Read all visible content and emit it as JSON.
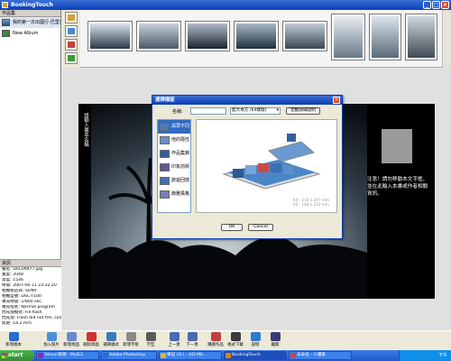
{
  "window": {
    "title": "BookingTouch"
  },
  "left_panel": {
    "header": "作品集",
    "albums": [
      {
        "label": "我的第一次出國行-巴里島",
        "icon": "photo-album-icon"
      },
      {
        "label": "New Album",
        "icon": "new-album-icon"
      }
    ],
    "info": {
      "header": "資訊",
      "rows": [
        "檔名: DSC09477.jpg",
        "寬度: 2048",
        "高度: 1536",
        "時間: 2007:06:11 23:32:20",
        "相機製造商: SONY",
        "相機型號: DSC-T100",
        "曝光時間: 1/800 sec.",
        "曝光程式: Normal program",
        "閃光燈模式: Fill flash",
        "閃光燈: Flash did not fire, compul",
        "焦距: 14.2 mm"
      ]
    }
  },
  "side_tools": [
    {
      "name": "photo-tool-icon"
    },
    {
      "name": "picture-tool-icon"
    },
    {
      "name": "paint-tool-icon"
    },
    {
      "name": "grid-tool-icon"
    }
  ],
  "thumbnails": [
    {
      "name": "sunset-sky",
      "colors": [
        "#2a3a4a",
        "#d8e2ea"
      ]
    },
    {
      "name": "couple-selfie",
      "colors": [
        "#4a5a6a",
        "#c8d0d8"
      ]
    },
    {
      "name": "silhouette-couple",
      "colors": [
        "#1a2430",
        "#b0bcc8"
      ]
    },
    {
      "name": "sunset-sea",
      "colors": [
        "#20303c",
        "#a8b8c4"
      ]
    },
    {
      "name": "ocean-horizon",
      "colors": [
        "#3a4650",
        "#c0ccd4"
      ]
    },
    {
      "name": "couple-portrait",
      "colors": [
        "#6a7a88",
        "#e8eef2"
      ]
    },
    {
      "name": "couple-beach",
      "colors": [
        "#5a6a78",
        "#dce4ea"
      ]
    },
    {
      "name": "man-portrait",
      "colors": [
        "#404a54",
        "#d0d8de"
      ]
    }
  ],
  "page": {
    "vertical_title": "請輸入書本名稱",
    "right_note": "注意！請勿移動本文字框，並在此輸入本書或作者相關資訊。"
  },
  "dialog": {
    "title": "選擇樣版",
    "name_label": "名稱:",
    "name_value": "",
    "size_select": "超大本方 (64樣版)",
    "custom_button": "宏觀詳細說明",
    "styles": [
      {
        "label": "與眾不同",
        "swatch": "#4a7ab8"
      },
      {
        "label": "他的隨性",
        "swatch": "#6a90c8"
      },
      {
        "label": "作品集錦",
        "swatch": "#3060a0"
      },
      {
        "label": "印象前衛",
        "swatch": "#5a5a9a"
      },
      {
        "label": "旅遊回憶",
        "swatch": "#4070b0"
      },
      {
        "label": "典雅風格",
        "swatch": "#7a7ab8"
      }
    ],
    "preview_caption": [
      "A4 : 210 x 297 mm",
      "A5 : 148 x 210 mm"
    ],
    "ok": "OK",
    "cancel": "Cancel"
  },
  "bottom_toolbar": [
    {
      "label": "新增相本",
      "icon": "new-book-icon",
      "color": "#2a6ad0"
    },
    {
      "label": "加入照片",
      "icon": "add-photo-icon",
      "color": "#4a90d8"
    },
    {
      "label": "新增頁面",
      "icon": "add-page-icon",
      "color": "#6a8ad0"
    },
    {
      "label": "刪除頁面",
      "icon": "delete-page-icon",
      "color": "#d03030"
    },
    {
      "label": "選擇樣式",
      "icon": "select-style-icon",
      "color": "#3a7ab8"
    },
    {
      "label": "新增字框",
      "icon": "add-textbox-icon",
      "color": "#8a8a8a"
    },
    {
      "label": "字型",
      "icon": "font-icon",
      "color": "#5a5a5a"
    },
    {
      "label": "上一頁",
      "icon": "prev-page-icon",
      "color": "#4a6ab0"
    },
    {
      "label": "下一頁",
      "icon": "next-page-icon",
      "color": "#4a6ab0"
    },
    {
      "label": "購買作品",
      "icon": "buy-icon",
      "color": "#c04040"
    },
    {
      "label": "格式下載",
      "icon": "download-icon",
      "color": "#3a3a3a"
    },
    {
      "label": "說明",
      "icon": "help-icon",
      "color": "#2a7ad0"
    },
    {
      "label": "離開",
      "icon": "exit-icon",
      "color": "#3a3a7a"
    }
  ],
  "taskbar": {
    "start": "start",
    "tasks": [
      {
        "label": "Yahoo!奇摩 - MyIE2",
        "icon_color": "#8a2ab8"
      },
      {
        "label": "Adobe Photoshop",
        "icon_color": "#2a6ad0"
      },
      {
        "label": "筆記 (G:) - sIO-Mit...",
        "icon_color": "#e0b030"
      },
      {
        "label": "BookingTouch",
        "icon_color": "#e08020"
      },
      {
        "label": "未命名 - 小畫家",
        "icon_color": "#d04040"
      }
    ],
    "tray_time": "下午"
  }
}
